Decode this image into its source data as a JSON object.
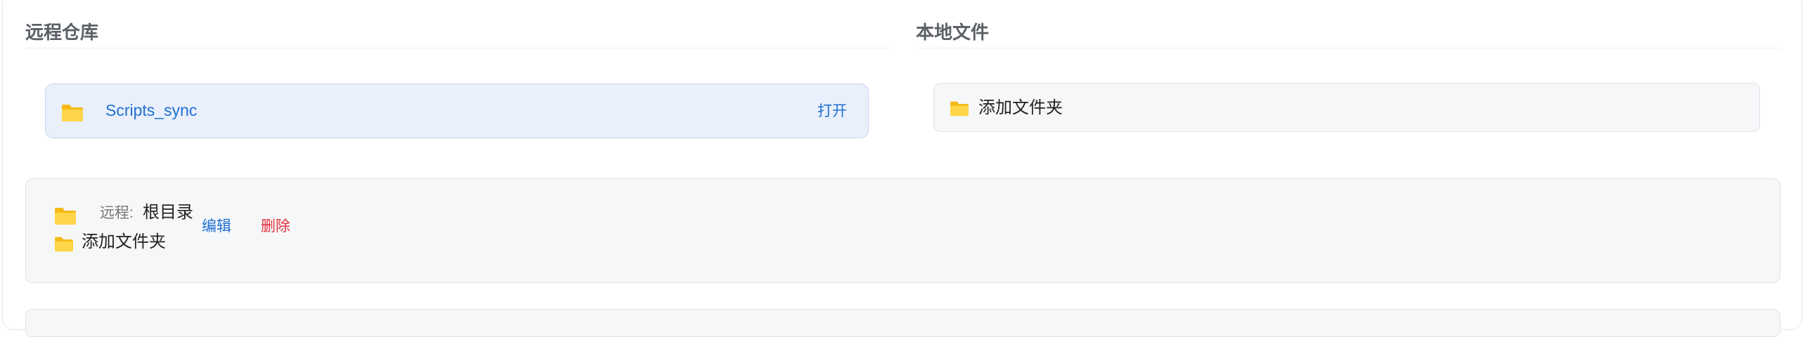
{
  "remote_section": {
    "title": "远程仓库",
    "repo": {
      "name": "Scripts_sync",
      "open_label": "打开"
    }
  },
  "local_section": {
    "title": "本地文件",
    "add_folder_label": "添加文件夹"
  },
  "mapping": {
    "remote_label": "远程:",
    "remote_value": "根目录",
    "local_label": "添加文件夹",
    "edit_label": "编辑",
    "delete_label": "删除"
  },
  "colors": {
    "accent": "#1f6fd1",
    "danger": "#e0313b",
    "folder": "#ffcc33",
    "selected_bg": "#e9f0fb"
  },
  "icons": [
    "folder-icon"
  ]
}
